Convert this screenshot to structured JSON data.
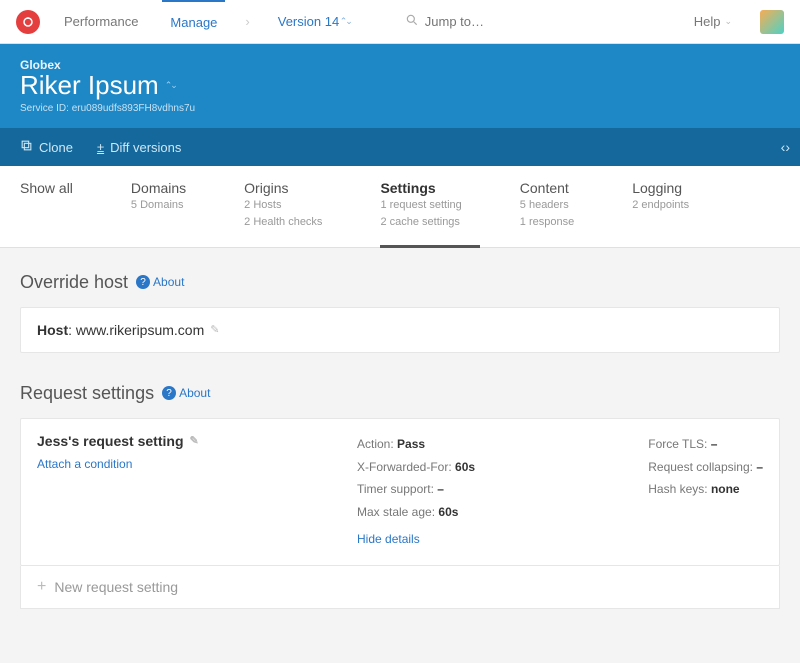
{
  "topnav": {
    "performance": "Performance",
    "manage": "Manage",
    "version": "Version 14",
    "search_placeholder": "Jump to…",
    "help": "Help"
  },
  "hero": {
    "org": "Globex",
    "service_name": "Riker Ipsum",
    "service_id_label": "Service ID:",
    "service_id": "eru089udfs893FH8vdhns7u"
  },
  "actionbar": {
    "clone": "Clone",
    "diff": "Diff versions"
  },
  "tabs": [
    {
      "label": "Show all",
      "sub1": "",
      "sub2": ""
    },
    {
      "label": "Domains",
      "sub1": "5 Domains",
      "sub2": ""
    },
    {
      "label": "Origins",
      "sub1": "2 Hosts",
      "sub2": "2 Health checks"
    },
    {
      "label": "Settings",
      "sub1": "1 request setting",
      "sub2": "2 cache settings"
    },
    {
      "label": "Content",
      "sub1": "5 headers",
      "sub2": "1 response"
    },
    {
      "label": "Logging",
      "sub1": "2 endpoints",
      "sub2": ""
    }
  ],
  "override_host": {
    "title": "Override host",
    "about": "About",
    "host_label": "Host",
    "host_value": "www.rikeripsum.com"
  },
  "request_settings": {
    "title": "Request settings",
    "about": "About",
    "item_name": "Jess's request setting",
    "attach": "Attach a condition",
    "mid": {
      "action_label": "Action:",
      "action_value": "Pass",
      "xff_label": "X-Forwarded-For:",
      "xff_value": "60s",
      "timer_label": "Timer support:",
      "timer_value": "–",
      "stale_label": "Max stale age:",
      "stale_value": "60s",
      "hide": "Hide details"
    },
    "right": {
      "tls_label": "Force TLS:",
      "tls_value": "–",
      "collapse_label": "Request collapsing:",
      "collapse_value": "–",
      "hash_label": "Hash keys:",
      "hash_value": "none"
    },
    "add_new": "New request setting"
  }
}
